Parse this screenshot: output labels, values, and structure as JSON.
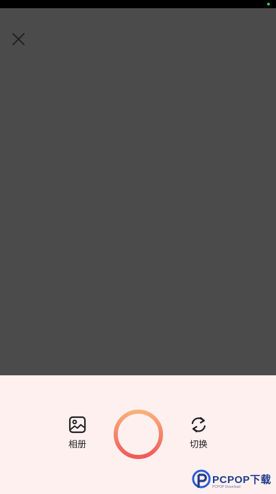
{
  "top_bar": {
    "close_icon": "close-icon"
  },
  "controls": {
    "album": {
      "icon": "image-icon",
      "label": "相册"
    },
    "shutter": {
      "icon": "shutter-ring",
      "gradient": [
        "#f9b07a",
        "#f15a5a"
      ]
    },
    "switch": {
      "icon": "refresh-icon",
      "label": "切换"
    }
  },
  "watermark": {
    "text": "PCPOP下载",
    "subtext": "PCPOP Download"
  },
  "colors": {
    "viewfinder": "#4b4b4b",
    "panel": "#fff0f0",
    "status_indicator": "#2ecc71"
  }
}
